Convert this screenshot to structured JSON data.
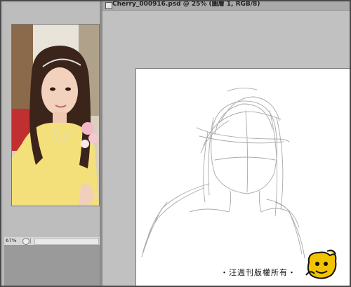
{
  "right_window": {
    "title": "Cherry_000916.psd @ 25% (圖層 1, RGB/8)"
  },
  "left_window": {
    "zoom": "67%",
    "photo_subject": "portrait photo of a girl"
  },
  "canvas": {
    "watermark": "・汪週刊版權所有・"
  },
  "icons": {
    "doc": "document-icon",
    "logo": "mascot-logo-icon",
    "status": "status-circle-icon"
  },
  "colors": {
    "workspace": "#b9b9b9",
    "canvas": "#ffffff",
    "logo_yellow": "#f2c300"
  }
}
